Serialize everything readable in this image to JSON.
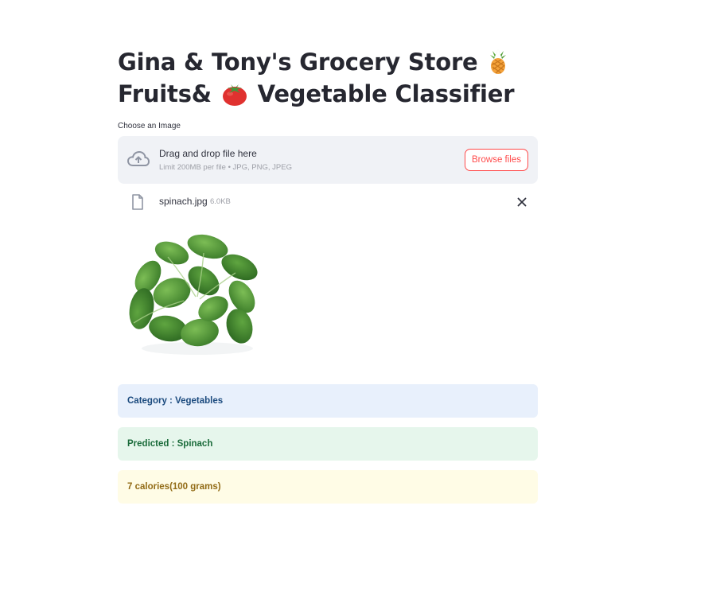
{
  "header": {
    "title_line1": "Gina & Tony's Grocery Store",
    "title_line2_a": "Fruits&",
    "title_line2_b": "Vegetable Classifier",
    "emoji_1": "pineapple-icon",
    "emoji_2": "tomato-icon"
  },
  "uploader": {
    "label": "Choose an Image",
    "drag_text": "Drag and drop file here",
    "limit_text": "Limit 200MB per file • JPG, PNG, JPEG",
    "browse_label": "Browse files",
    "icon": "cloud-upload-icon"
  },
  "file": {
    "name": "spinach.jpg",
    "size": "6.0KB",
    "icon": "file-icon",
    "remove_icon": "close-icon"
  },
  "image": {
    "subject": "spinach"
  },
  "results": {
    "category": "Category : Vegetables",
    "predicted": "Predicted : Spinach",
    "calories": "7 calories(100 grams)"
  },
  "colors": {
    "accent": "#ff4b4b",
    "info_bg": "#e8f0fc",
    "success_bg": "#e6f6ec",
    "warning_bg": "#fffce6"
  }
}
